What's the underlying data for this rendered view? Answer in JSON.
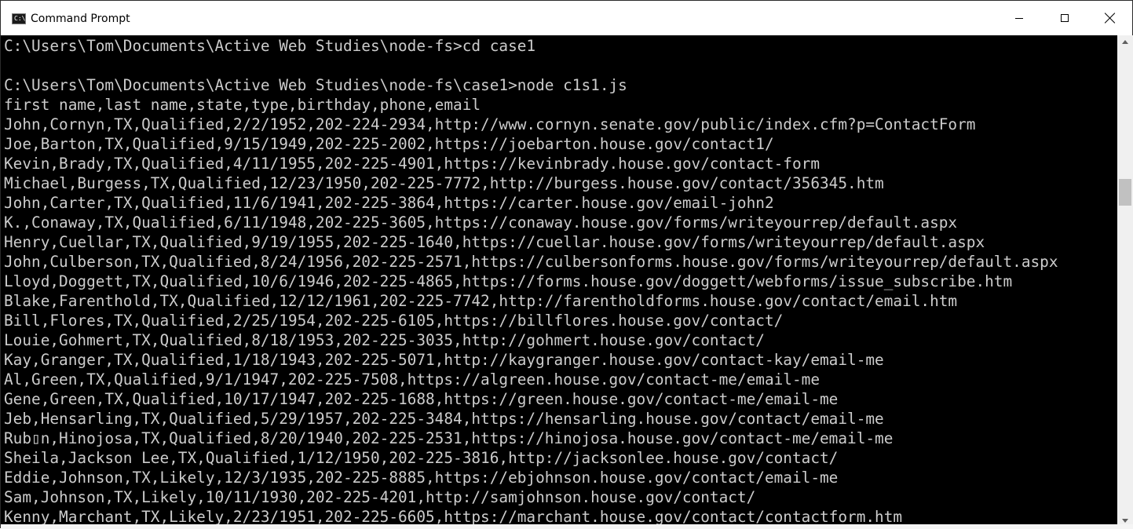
{
  "window": {
    "title": "Command Prompt",
    "icon": "console-icon",
    "icon_glyph": "C:\\"
  },
  "colors": {
    "background": "#000000",
    "text": "#cccccc",
    "titlebar": "#ffffff"
  },
  "console": {
    "lines": [
      "C:\\Users\\Tom\\Documents\\Active Web Studies\\node-fs>cd case1",
      "",
      "C:\\Users\\Tom\\Documents\\Active Web Studies\\node-fs\\case1>node c1s1.js",
      "first name,last name,state,type,birthday,phone,email",
      "John,Cornyn,TX,Qualified,2/2/1952,202-224-2934,http://www.cornyn.senate.gov/public/index.cfm?p=ContactForm",
      "Joe,Barton,TX,Qualified,9/15/1949,202-225-2002,https://joebarton.house.gov/contact1/",
      "Kevin,Brady,TX,Qualified,4/11/1955,202-225-4901,https://kevinbrady.house.gov/contact-form",
      "Michael,Burgess,TX,Qualified,12/23/1950,202-225-7772,http://burgess.house.gov/contact/356345.htm",
      "John,Carter,TX,Qualified,11/6/1941,202-225-3864,https://carter.house.gov/email-john2",
      "K.,Conaway,TX,Qualified,6/11/1948,202-225-3605,https://conaway.house.gov/forms/writeyourrep/default.aspx",
      "Henry,Cuellar,TX,Qualified,9/19/1955,202-225-1640,https://cuellar.house.gov/forms/writeyourrep/default.aspx",
      "John,Culberson,TX,Qualified,8/24/1956,202-225-2571,https://culbersonforms.house.gov/forms/writeyourrep/default.aspx",
      "Lloyd,Doggett,TX,Qualified,10/6/1946,202-225-4865,https://forms.house.gov/doggett/webforms/issue_subscribe.htm",
      "Blake,Farenthold,TX,Qualified,12/12/1961,202-225-7742,http://farentholdforms.house.gov/contact/email.htm",
      "Bill,Flores,TX,Qualified,2/25/1954,202-225-6105,https://billflores.house.gov/contact/",
      "Louie,Gohmert,TX,Qualified,8/18/1953,202-225-3035,http://gohmert.house.gov/contact/",
      "Kay,Granger,TX,Qualified,1/18/1943,202-225-5071,http://kaygranger.house.gov/contact-kay/email-me",
      "Al,Green,TX,Qualified,9/1/1947,202-225-7508,https://algreen.house.gov/contact-me/email-me",
      "Gene,Green,TX,Qualified,10/17/1947,202-225-1688,https://green.house.gov/contact-me/email-me",
      "Jeb,Hensarling,TX,Qualified,5/29/1957,202-225-3484,https://hensarling.house.gov/contact/email-me",
      "Rub▯n,Hinojosa,TX,Qualified,8/20/1940,202-225-2531,https://hinojosa.house.gov/contact-me/email-me",
      "Sheila,Jackson Lee,TX,Qualified,1/12/1950,202-225-3816,http://jacksonlee.house.gov/contact/",
      "Eddie,Johnson,TX,Likely,12/3/1935,202-225-8885,https://ebjohnson.house.gov/contact/email-me",
      "Sam,Johnson,TX,Likely,10/11/1930,202-225-4201,http://samjohnson.house.gov/contact/",
      "Kenny,Marchant,TX,Likely,2/23/1951,202-225-6605,https://marchant.house.gov/contact/contactform.htm"
    ]
  },
  "controls": {
    "minimize": "minimize-icon",
    "maximize": "maximize-icon",
    "close": "close-icon"
  }
}
